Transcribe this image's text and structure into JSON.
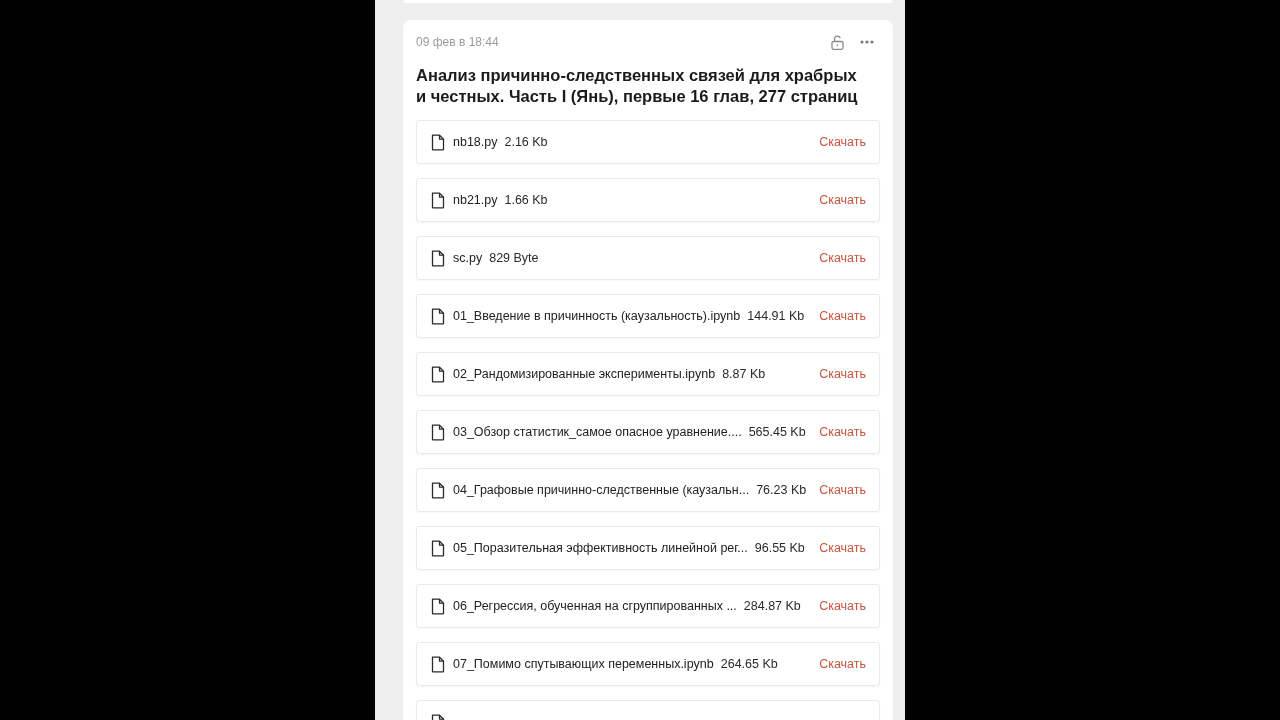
{
  "post": {
    "date": "09 фев в 18:44",
    "title": "Анализ причинно-следственных связей для храбрых и честных. Часть I (Янь), первые 16 глав, 277 страниц",
    "files": [
      {
        "name": "nb18.py",
        "size": "2.16 Kb",
        "action": "Скачать"
      },
      {
        "name": "nb21.py",
        "size": "1.66 Kb",
        "action": "Скачать"
      },
      {
        "name": "sc.py",
        "size": "829 Byte",
        "action": "Скачать"
      },
      {
        "name": "01_Введение в причинность (каузальность).ipynb",
        "size": "144.91 Kb",
        "action": "Скачать"
      },
      {
        "name": "02_Рандомизированные эксперименты.ipynb",
        "size": "8.87 Kb",
        "action": "Скачать"
      },
      {
        "name": "03_Обзор статистик_самое опасное уравнение....",
        "size": "565.45 Kb",
        "action": "Скачать"
      },
      {
        "name": "04_Графовые причинно-следственные (каузальн...",
        "size": "76.23 Kb",
        "action": "Скачать"
      },
      {
        "name": "05_Поразительная эффективность линейной рег...",
        "size": "96.55 Kb",
        "action": "Скачать"
      },
      {
        "name": "06_Регрессия, обученная на сгруппированных ...",
        "size": "284.87 Kb",
        "action": "Скачать"
      },
      {
        "name": "07_Помимо спутывающих переменных.ipynb",
        "size": "264.65 Kb",
        "action": "Скачать"
      }
    ]
  }
}
